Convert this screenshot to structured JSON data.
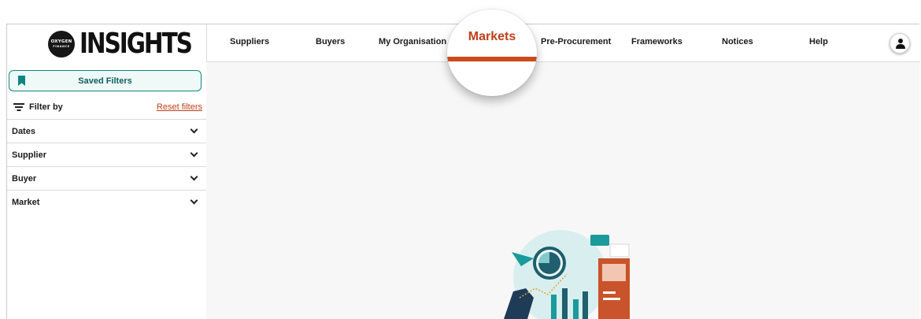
{
  "brand": {
    "name": "INSIGHTS",
    "badge_line1": "OXYGEN",
    "badge_line2": "FINANCE"
  },
  "nav": {
    "items": [
      "Suppliers",
      "Buyers",
      "My Organisation",
      "Markets",
      "Pre-Procurement",
      "Frameworks",
      "Notices",
      "Help"
    ],
    "active": "Markets"
  },
  "sidebar": {
    "saved_filters": "Saved Filters",
    "filter_by": "Filter by",
    "reset_filters": "Reset filters",
    "sections": [
      "Dates",
      "Supplier",
      "Buyer",
      "Market"
    ]
  },
  "colors": {
    "accent_teal": "#0f8585",
    "accent_orange": "#c0401a"
  },
  "icons": [
    "bookmark-icon",
    "filter-icon",
    "chevron-down-icon",
    "user-icon"
  ]
}
